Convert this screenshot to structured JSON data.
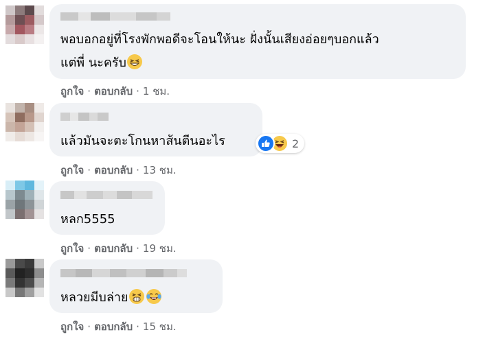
{
  "comments": [
    {
      "text_line1": "พอบอกอยู่ที่โรงพักพอดีจะโอนให้นะ ฝั่งนั้นเสียงอ่อยๆบอกแล้ว",
      "text_line2": "แต่พี่ นะครับ",
      "inline_emoji": [
        "grinning-squinting-emoji"
      ],
      "like": "ถูกใจ",
      "reply": "ตอบกลับ",
      "time": "1 ชม."
    },
    {
      "text_line1": "แล้วมันจะตะโกนหาส้นตีนอะไร",
      "reactions": [
        "like-reaction-icon",
        "haha-reaction-icon"
      ],
      "reaction_count": "2",
      "like": "ถูกใจ",
      "reply": "ตอบกลับ",
      "time": "13 ชม."
    },
    {
      "text_line1": "หลก5555",
      "like": "ถูกใจ",
      "reply": "ตอบกลับ",
      "time": "19 ชม."
    },
    {
      "text_line1": "หลวยมีบล่าย",
      "inline_emoji": [
        "gasping-emoji",
        "tears-of-joy-emoji"
      ],
      "like": "ถูกใจ",
      "reply": "ตอบกลับ",
      "time": "15 ชม."
    }
  ],
  "dot": "·",
  "colors": {
    "bubble": "#f0f2f5",
    "meta_text": "#65676b",
    "like_blue": "#1877f2",
    "emoji_yellow": "#f7c94b"
  }
}
